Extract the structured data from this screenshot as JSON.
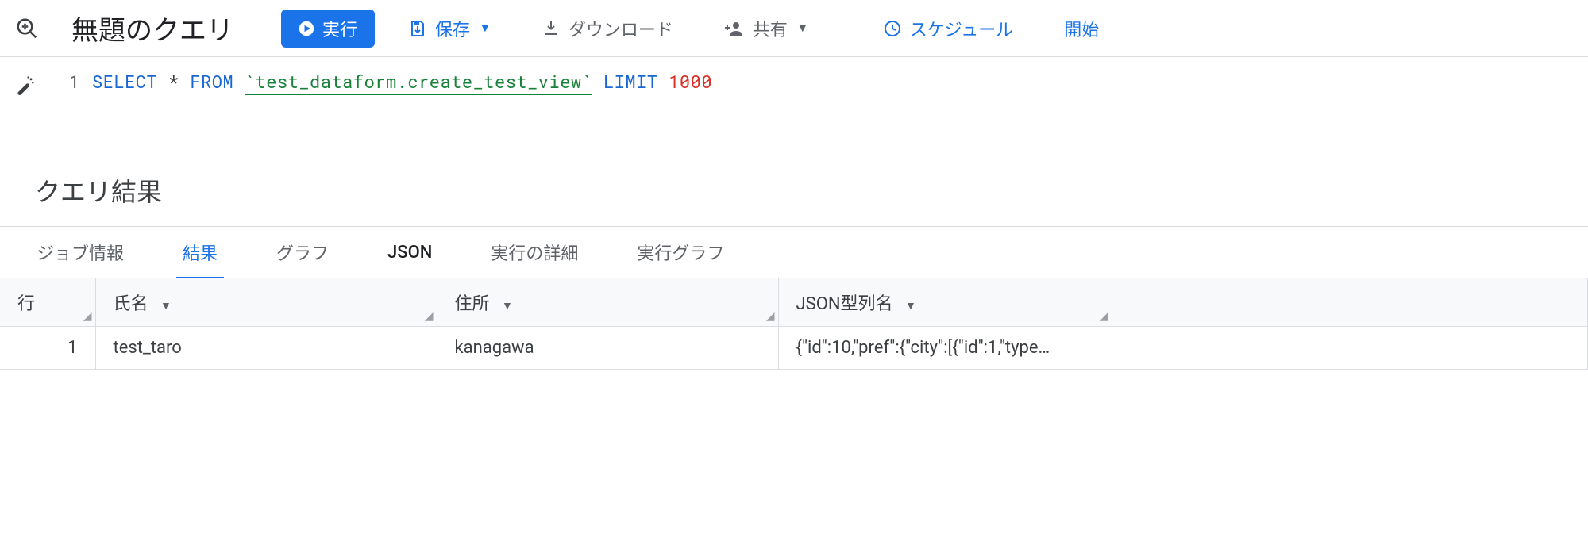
{
  "header": {
    "title": "無題のクエリ",
    "run": "実行",
    "save": "保存",
    "download": "ダウンロード",
    "share": "共有",
    "schedule": "スケジュール",
    "open": "開始"
  },
  "editor": {
    "line_number": "1",
    "sql_select": "SELECT",
    "sql_star": "*",
    "sql_from": "FROM",
    "sql_ref": "`test_dataform.create_test_view`",
    "sql_limit": "LIMIT",
    "sql_limit_n": "1000"
  },
  "results": {
    "heading": "クエリ結果",
    "tabs": {
      "job_info": "ジョブ情報",
      "results": "結果",
      "chart": "グラフ",
      "json": "JSON",
      "exec_details": "実行の詳細",
      "exec_graph": "実行グラフ"
    },
    "columns": {
      "row": "行",
      "name": "氏名",
      "addr": "住所",
      "json_col": "JSON型列名"
    },
    "rows": [
      {
        "idx": "1",
        "name": "test_taro",
        "addr": "kanagawa",
        "json": "{\"id\":10,\"pref\":{\"city\":[{\"id\":1,\"type…"
      }
    ]
  }
}
